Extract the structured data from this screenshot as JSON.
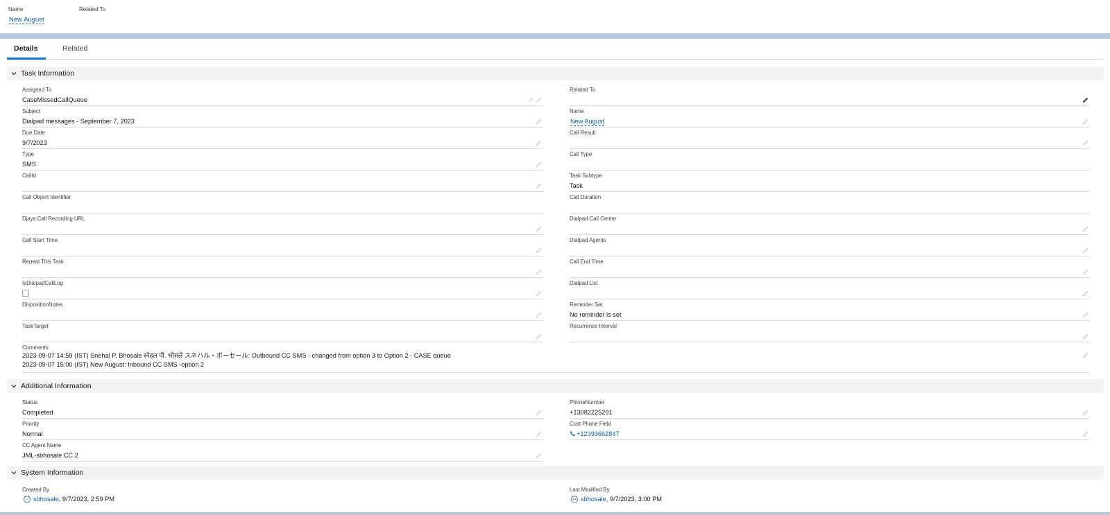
{
  "header": {
    "name_label": "Name",
    "related_label": "Related To",
    "name_value": "New August"
  },
  "tabs": [
    {
      "label": "Details",
      "active": true
    },
    {
      "label": "Related",
      "active": false
    }
  ],
  "sections": {
    "task": "Task Information",
    "additional": "Additional Information",
    "system": "System Information"
  },
  "task_fields": {
    "assigned_to": {
      "label": "Assigned To",
      "value": "CaseMissedCallQueue"
    },
    "related_to": {
      "label": "Related To",
      "value": ""
    },
    "subject": {
      "label": "Subject",
      "value": "Dialpad messages - September 7, 2023"
    },
    "name": {
      "label": "Name",
      "value": "New August"
    },
    "due_date": {
      "label": "Due Date",
      "value": "9/7/2023"
    },
    "call_result": {
      "label": "Call Result",
      "value": ""
    },
    "type": {
      "label": "Type",
      "value": "SMS"
    },
    "call_type": {
      "label": "Call Type",
      "value": ""
    },
    "callid": {
      "label": "CallId",
      "value": ""
    },
    "task_subtype": {
      "label": "Task Subtype",
      "value": "Task"
    },
    "call_object_identifier": {
      "label": "Call Object Identifier",
      "value": ""
    },
    "call_duration": {
      "label": "Call Duration",
      "value": ""
    },
    "djays_call_recording_url": {
      "label": "Djays Call Recording URL",
      "value": ""
    },
    "dialpad_call_center": {
      "label": "Dialpad Call Center",
      "value": ""
    },
    "call_start_time": {
      "label": "Call Start Time",
      "value": ""
    },
    "dialpad_agents": {
      "label": "Dialpad Agents",
      "value": ""
    },
    "repeat_this_task": {
      "label": "Repeat This Task",
      "value": ""
    },
    "call_end_time": {
      "label": "Call End Time",
      "value": ""
    },
    "isdialpadcalllog": {
      "label": "IsDialpadCallLog",
      "checked": false
    },
    "dialpad_list": {
      "label": "Dialpad List",
      "value": ""
    },
    "disposition_notes": {
      "label": "DispositionNotes",
      "value": ""
    },
    "reminder_set": {
      "label": "Reminder Set",
      "value": "No reminder is set"
    },
    "task_target": {
      "label": "TaskTarget",
      "value": ""
    },
    "recurrence_interval": {
      "label": "Recurrence Interval",
      "value": ""
    },
    "comments": {
      "label": "Comments",
      "line1": "2023-09-07 14:59 (IST) Snehal P. Bhosale स्नेहल पी. भोसले スネハル・ポーセール: Outbound CC SMS - changed from option 3 to Option 2 - CASE queue",
      "line2": "2023-09-07 15:00 (IST) New August: Inbound CC SMS -option 2"
    }
  },
  "additional_fields": {
    "status": {
      "label": "Status",
      "value": "Completed"
    },
    "phone_number": {
      "label": "PhoneNumber",
      "value": "+13082225291"
    },
    "priority": {
      "label": "Priority",
      "value": "Normal"
    },
    "cust_phone_field": {
      "label": "Cust Phone Field",
      "value": "+12393662847"
    },
    "cc_agent_name": {
      "label": "CC Agent Name",
      "value": "JML-sbhosale CC 2"
    }
  },
  "system_fields": {
    "created_by": {
      "label": "Created By",
      "user": "sbhosale",
      "date": ", 9/7/2023, 2:59 PM"
    },
    "last_modified_by": {
      "label": "Last Modified By",
      "user": "sbhosale",
      "date": ", 9/7/2023, 3:00 PM"
    }
  },
  "colors": {
    "link": "#0b5cab",
    "accent": "#0176d3",
    "band": "#b6c8dd",
    "section_bg": "#f3f3f3"
  }
}
